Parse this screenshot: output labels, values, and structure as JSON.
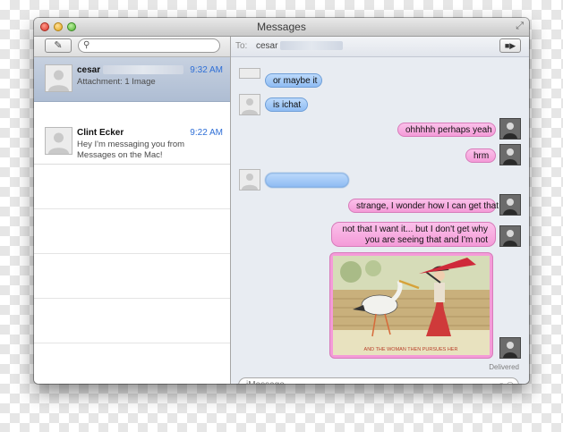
{
  "window": {
    "title": "Messages"
  },
  "sidebar": {
    "search": {
      "placeholder": ""
    },
    "conversations": [
      {
        "name": "cesar",
        "time": "9:32 AM",
        "preview": "Attachment: 1 Image",
        "selected": true
      },
      {
        "name": "Clint Ecker",
        "time": "9:22 AM",
        "preview": "Hey I'm messaging you from Messages on the Mac!",
        "selected": false
      }
    ]
  },
  "chat": {
    "to_label": "To:",
    "to_name": "cesar",
    "messages": [
      {
        "side": "received",
        "text": "or maybe it"
      },
      {
        "side": "received",
        "text": "is ichat"
      },
      {
        "side": "sent",
        "text": "ohhhhh perhaps yeah"
      },
      {
        "side": "sent",
        "text": "hrm"
      },
      {
        "side": "received",
        "text": ""
      },
      {
        "side": "sent",
        "text": "strange, I wonder how I can get that"
      },
      {
        "side": "sent",
        "text": "not that I want it... but I don't get why you are seeing that and I'm not"
      },
      {
        "side": "sent",
        "type": "image",
        "caption": "AND THE WOMAN THEN PURSUES HER"
      }
    ],
    "status": "Delivered",
    "input": {
      "placeholder": "iMessage"
    }
  },
  "colors": {
    "received_bubble": "#8fbcf3",
    "sent_bubble": "#f49bd8",
    "selected_row": "#aebdd3",
    "time_text": "#2f6fd6"
  },
  "icons": {
    "compose": "compose-icon",
    "search": "search-icon",
    "video": "video-camera-icon",
    "emoji": "emoji-icon",
    "fullscreen": "fullscreen-icon"
  }
}
